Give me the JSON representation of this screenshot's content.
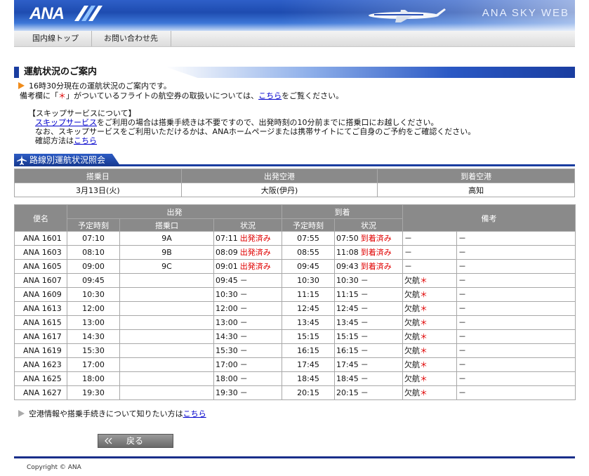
{
  "header": {
    "logo": "ANA",
    "brand": "ANA SKY WEB"
  },
  "nav": {
    "items": [
      {
        "label": "国内線トップ"
      },
      {
        "label": "お問い合わせ先"
      }
    ]
  },
  "page": {
    "title": "運航状況のご案内"
  },
  "notice": {
    "line1": "16時30分現在の運航状況のご案内です。",
    "line2_pre": "備考欄に「",
    "line2_star": "＊",
    "line2_mid": "」がついているフライトの航空券の取扱いについては、",
    "line2_link": "こちら",
    "line2_post": "をご覧ください。"
  },
  "skip": {
    "heading": "【スキップサービスについて】",
    "line1_link": "スキップサービス",
    "line1_post": "をご利用の場合は搭乗手続きは不要ですので、出発時刻の10分前までに搭乗口にお越しください。",
    "line2": "なお、スキップサービスをご利用いただけるかは、ANAホームページまたは携帯サイトにてご自身のご予約をご確認ください。",
    "line3_pre": "確認方法は",
    "line3_link": "こちら"
  },
  "section": {
    "title": "路線別運航状況照会"
  },
  "route": {
    "headers": [
      "搭乗日",
      "出発空港",
      "到着空港"
    ],
    "values": [
      "3月13日(火)",
      "大阪(伊丹)",
      "高知"
    ]
  },
  "flights_header": {
    "flight": "便名",
    "departure": "出発",
    "arrival": "到着",
    "remarks": "備考",
    "dep_time": "予定時刻",
    "gate": "搭乗口",
    "dep_status": "状況",
    "arr_time": "予定時刻",
    "arr_status": "状況"
  },
  "flights": [
    {
      "flight": "ANA 1601",
      "dep": "07:10",
      "gate": "9A",
      "dep_actual": "07:11",
      "dep_note": "出発済み",
      "arr": "07:55",
      "arr_actual": "07:50",
      "arr_note": "到着済み",
      "remark1": "－",
      "remark1_star": "",
      "remark2": "－"
    },
    {
      "flight": "ANA 1603",
      "dep": "08:10",
      "gate": "9B",
      "dep_actual": "08:09",
      "dep_note": "出発済み",
      "arr": "08:55",
      "arr_actual": "11:08",
      "arr_note": "到着済み",
      "remark1": "－",
      "remark1_star": "",
      "remark2": "－"
    },
    {
      "flight": "ANA 1605",
      "dep": "09:00",
      "gate": "9C",
      "dep_actual": "09:01",
      "dep_note": "出発済み",
      "arr": "09:45",
      "arr_actual": "09:43",
      "arr_note": "到着済み",
      "remark1": "－",
      "remark1_star": "",
      "remark2": "－"
    },
    {
      "flight": "ANA 1607",
      "dep": "09:45",
      "gate": "",
      "dep_actual": "09:45",
      "dep_note": "－",
      "arr": "10:30",
      "arr_actual": "10:30",
      "arr_note": "－",
      "remark1": "欠航",
      "remark1_star": "＊",
      "remark2": "－"
    },
    {
      "flight": "ANA 1609",
      "dep": "10:30",
      "gate": "",
      "dep_actual": "10:30",
      "dep_note": "－",
      "arr": "11:15",
      "arr_actual": "11:15",
      "arr_note": "－",
      "remark1": "欠航",
      "remark1_star": "＊",
      "remark2": "－"
    },
    {
      "flight": "ANA 1613",
      "dep": "12:00",
      "gate": "",
      "dep_actual": "12:00",
      "dep_note": "－",
      "arr": "12:45",
      "arr_actual": "12:45",
      "arr_note": "－",
      "remark1": "欠航",
      "remark1_star": "＊",
      "remark2": "－"
    },
    {
      "flight": "ANA 1615",
      "dep": "13:00",
      "gate": "",
      "dep_actual": "13:00",
      "dep_note": "－",
      "arr": "13:45",
      "arr_actual": "13:45",
      "arr_note": "－",
      "remark1": "欠航",
      "remark1_star": "＊",
      "remark2": "－"
    },
    {
      "flight": "ANA 1617",
      "dep": "14:30",
      "gate": "",
      "dep_actual": "14:30",
      "dep_note": "－",
      "arr": "15:15",
      "arr_actual": "15:15",
      "arr_note": "－",
      "remark1": "欠航",
      "remark1_star": "＊",
      "remark2": "－"
    },
    {
      "flight": "ANA 1619",
      "dep": "15:30",
      "gate": "",
      "dep_actual": "15:30",
      "dep_note": "－",
      "arr": "16:15",
      "arr_actual": "16:15",
      "arr_note": "－",
      "remark1": "欠航",
      "remark1_star": "＊",
      "remark2": "－"
    },
    {
      "flight": "ANA 1623",
      "dep": "17:00",
      "gate": "",
      "dep_actual": "17:00",
      "dep_note": "－",
      "arr": "17:45",
      "arr_actual": "17:45",
      "arr_note": "－",
      "remark1": "欠航",
      "remark1_star": "＊",
      "remark2": "－"
    },
    {
      "flight": "ANA 1625",
      "dep": "18:00",
      "gate": "",
      "dep_actual": "18:00",
      "dep_note": "－",
      "arr": "18:45",
      "arr_actual": "18:45",
      "arr_note": "－",
      "remark1": "欠航",
      "remark1_star": "＊",
      "remark2": "－"
    },
    {
      "flight": "ANA 1627",
      "dep": "19:30",
      "gate": "",
      "dep_actual": "19:30",
      "dep_note": "－",
      "arr": "20:15",
      "arr_actual": "20:15",
      "arr_note": "－",
      "remark1": "欠航",
      "remark1_star": "＊",
      "remark2": "－"
    }
  ],
  "airport_info": {
    "pre": "空港情報や搭乗手続きについて知りたい方は",
    "link": "こちら"
  },
  "back": {
    "label": "戻る"
  },
  "footer": {
    "copyright": "Copyright © ANA"
  },
  "colors": {
    "brand_blue": "#1a3da0",
    "header_gray": "#8a8a8a",
    "alert_red": "#e00000",
    "bullet_orange": "#f08c1c",
    "link_blue": "#0000cc"
  }
}
